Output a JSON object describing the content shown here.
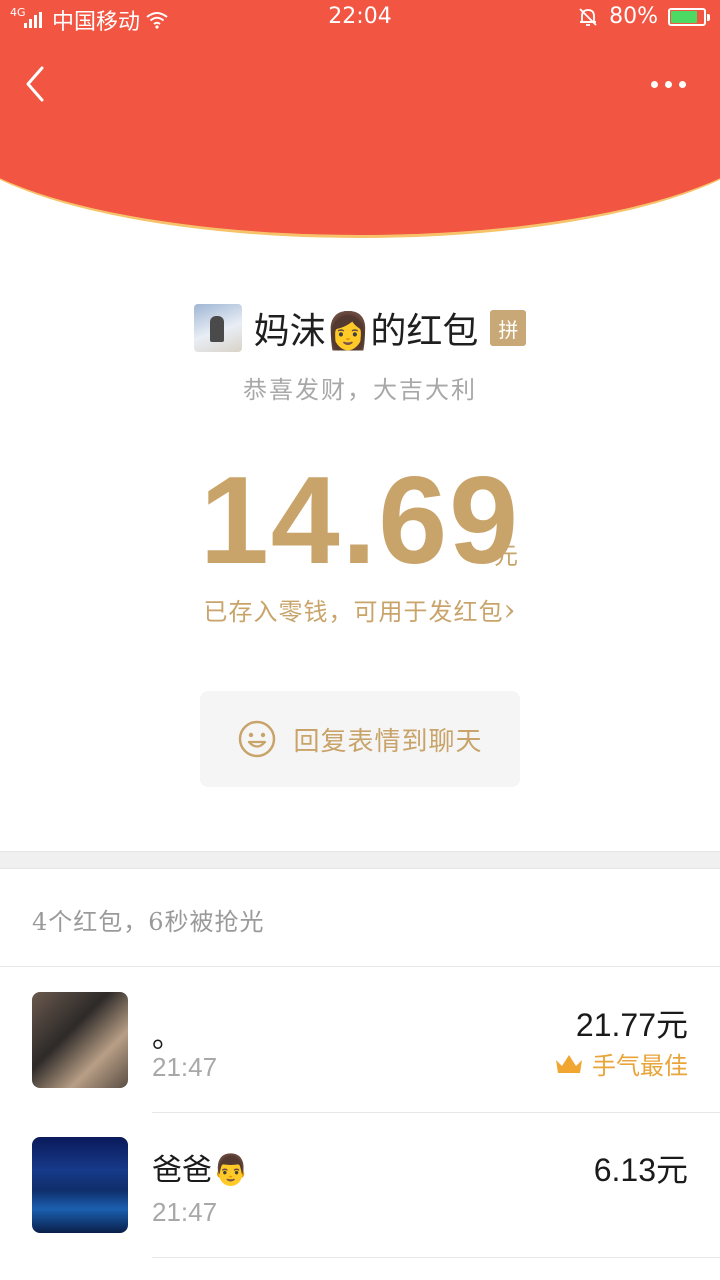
{
  "status_bar": {
    "network": "4G",
    "carrier": "中国移动",
    "time": "22:04",
    "battery": "80%",
    "battery_level": 0.8,
    "battery_color": "#4cd964"
  },
  "header": {
    "bg_color": "#f25542",
    "back_icon": "chevron-left-icon",
    "more_icon": "more-dots-icon"
  },
  "packet": {
    "sender_name": "妈沫👩的红包",
    "group_badge": "拼",
    "blessing": "恭喜发财，大吉大利",
    "amount": "14.69",
    "unit": "元",
    "saved_text": "已存入零钱，可用于发红包",
    "saved_chevron": "›",
    "accent_color": "#c9a46a"
  },
  "reply": {
    "label": "回复表情到聊天",
    "icon": "smile-icon"
  },
  "summary": "4个红包，6秒被抢光",
  "recipients": [
    {
      "name": "。",
      "time": "21:47",
      "amount": "21.77元",
      "best_label": "手气最佳",
      "best_icon": "crown-icon"
    },
    {
      "name": "爸爸👨",
      "time": "21:47",
      "amount": "6.13元"
    }
  ]
}
